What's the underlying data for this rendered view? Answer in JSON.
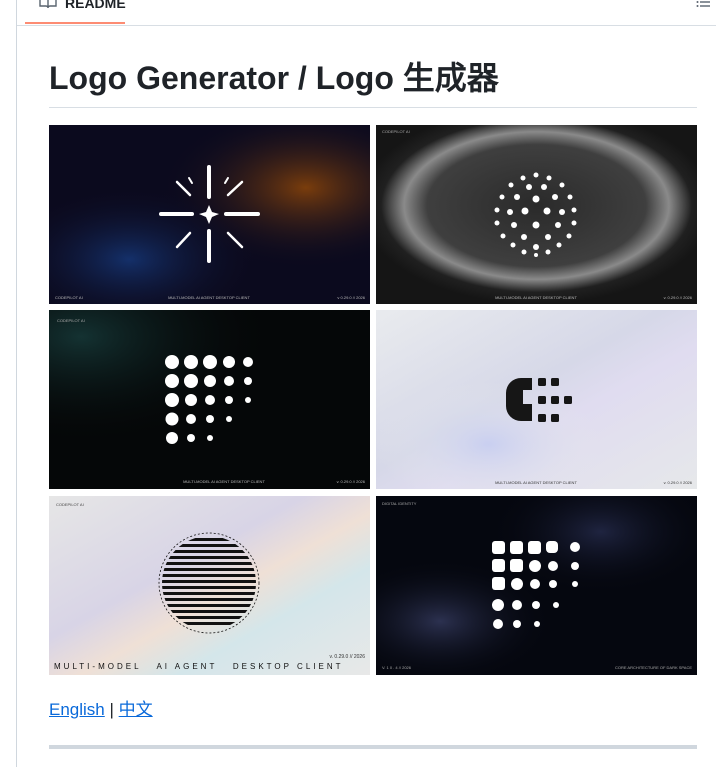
{
  "readme_tab": {
    "label": "README",
    "icon": "book-icon"
  },
  "toc": {
    "icon": "list-icon"
  },
  "heading": "Logo Generator / Logo 生成器",
  "gallery": [
    {
      "corner_top": "",
      "corner_bottom_left": "CODEPILOT AI",
      "center_caption": "MULTI-MODEL AI AGENT DESKTOP CLIENT",
      "version": "v 0.29.0 // 2026"
    },
    {
      "corner_top": "CODEPILOT AI",
      "corner_bottom_left": "",
      "center_caption": "MULTI-MODEL AI AGENT DESKTOP CLIENT",
      "version": "v. 0.29.0 // 2026"
    },
    {
      "corner_top": "CODEPILOT AI",
      "corner_bottom_left": "",
      "center_caption": "MULTI-MODEL AI AGENT DESKTOP CLIENT",
      "version": "v. 0.29.0 // 2026"
    },
    {
      "corner_top": "",
      "corner_bottom_left": "",
      "center_caption": "MULTI-MODEL AI AGENT DESKTOP CLIENT",
      "version": "v. 0.29.0 // 2026"
    },
    {
      "corner_top": "CODEPILOT AI",
      "corner_bottom_left": "MULTI-MODEL   AI AGENT   DESKTOP CLIENT",
      "center_caption": "",
      "version": "v. 0.29.0 // 2026"
    },
    {
      "corner_top": "DIGITAL IDENTITY",
      "corner_bottom_left": "V. 1 0 . 4 // 2026",
      "center_caption": "",
      "version": "CORE ARCHITECTURE OF DARK SPACE"
    }
  ],
  "links": {
    "english": "English",
    "separator": "|",
    "chinese": "中文"
  },
  "colors": {
    "link": "#0969da",
    "tab_accent": "#fd8c73"
  }
}
